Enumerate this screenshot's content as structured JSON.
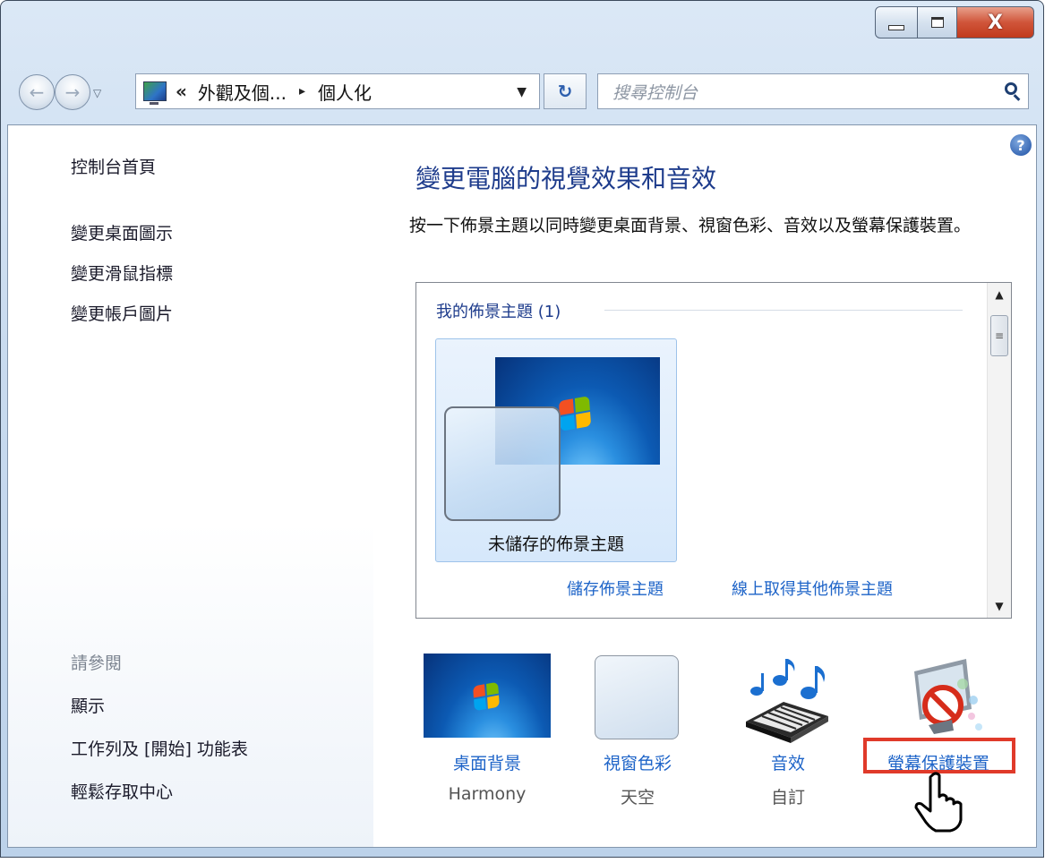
{
  "window": {
    "controls": {
      "minimize": "minimize",
      "maximize": "maximize",
      "close": "X"
    }
  },
  "navigation": {
    "address": {
      "chevron": "«",
      "segments": [
        "外觀及個...",
        "個人化"
      ],
      "separator": "▸"
    },
    "search_placeholder": "搜尋控制台"
  },
  "sidebar": {
    "home_link": "控制台首頁",
    "links": [
      "變更桌面圖示",
      "變更滑鼠指標",
      "變更帳戶圖片"
    ],
    "see_also": {
      "heading": "請參閱",
      "links": [
        "顯示",
        "工作列及 [開始] 功能表",
        "輕鬆存取中心"
      ]
    }
  },
  "main": {
    "help_icon": "?",
    "title": "變更電腦的視覺效果和音效",
    "description": "按一下佈景主題以同時變更桌面背景、視窗色彩、音效以及螢幕保護裝置。",
    "theme_group": {
      "header": "我的佈景主題 (1)",
      "tile_label": "未儲存的佈景主題",
      "save_link": "儲存佈景主題",
      "online_link": "線上取得其他佈景主題",
      "scroll_thumb": "≡"
    },
    "settings": [
      {
        "label": "桌面背景",
        "value": "Harmony",
        "icon": "desktop-background-icon"
      },
      {
        "label": "視窗色彩",
        "value": "天空",
        "icon": "window-color-icon"
      },
      {
        "label": "音效",
        "value": "自訂",
        "icon": "sounds-icon"
      },
      {
        "label": "螢幕保護裝置",
        "value": "",
        "icon": "screen-saver-icon"
      }
    ]
  },
  "colors": {
    "title_blue": "#1e3c8c",
    "link_blue": "#1e64c8",
    "highlight_red": "#e03a2a",
    "close_red": "#c13a1c"
  }
}
